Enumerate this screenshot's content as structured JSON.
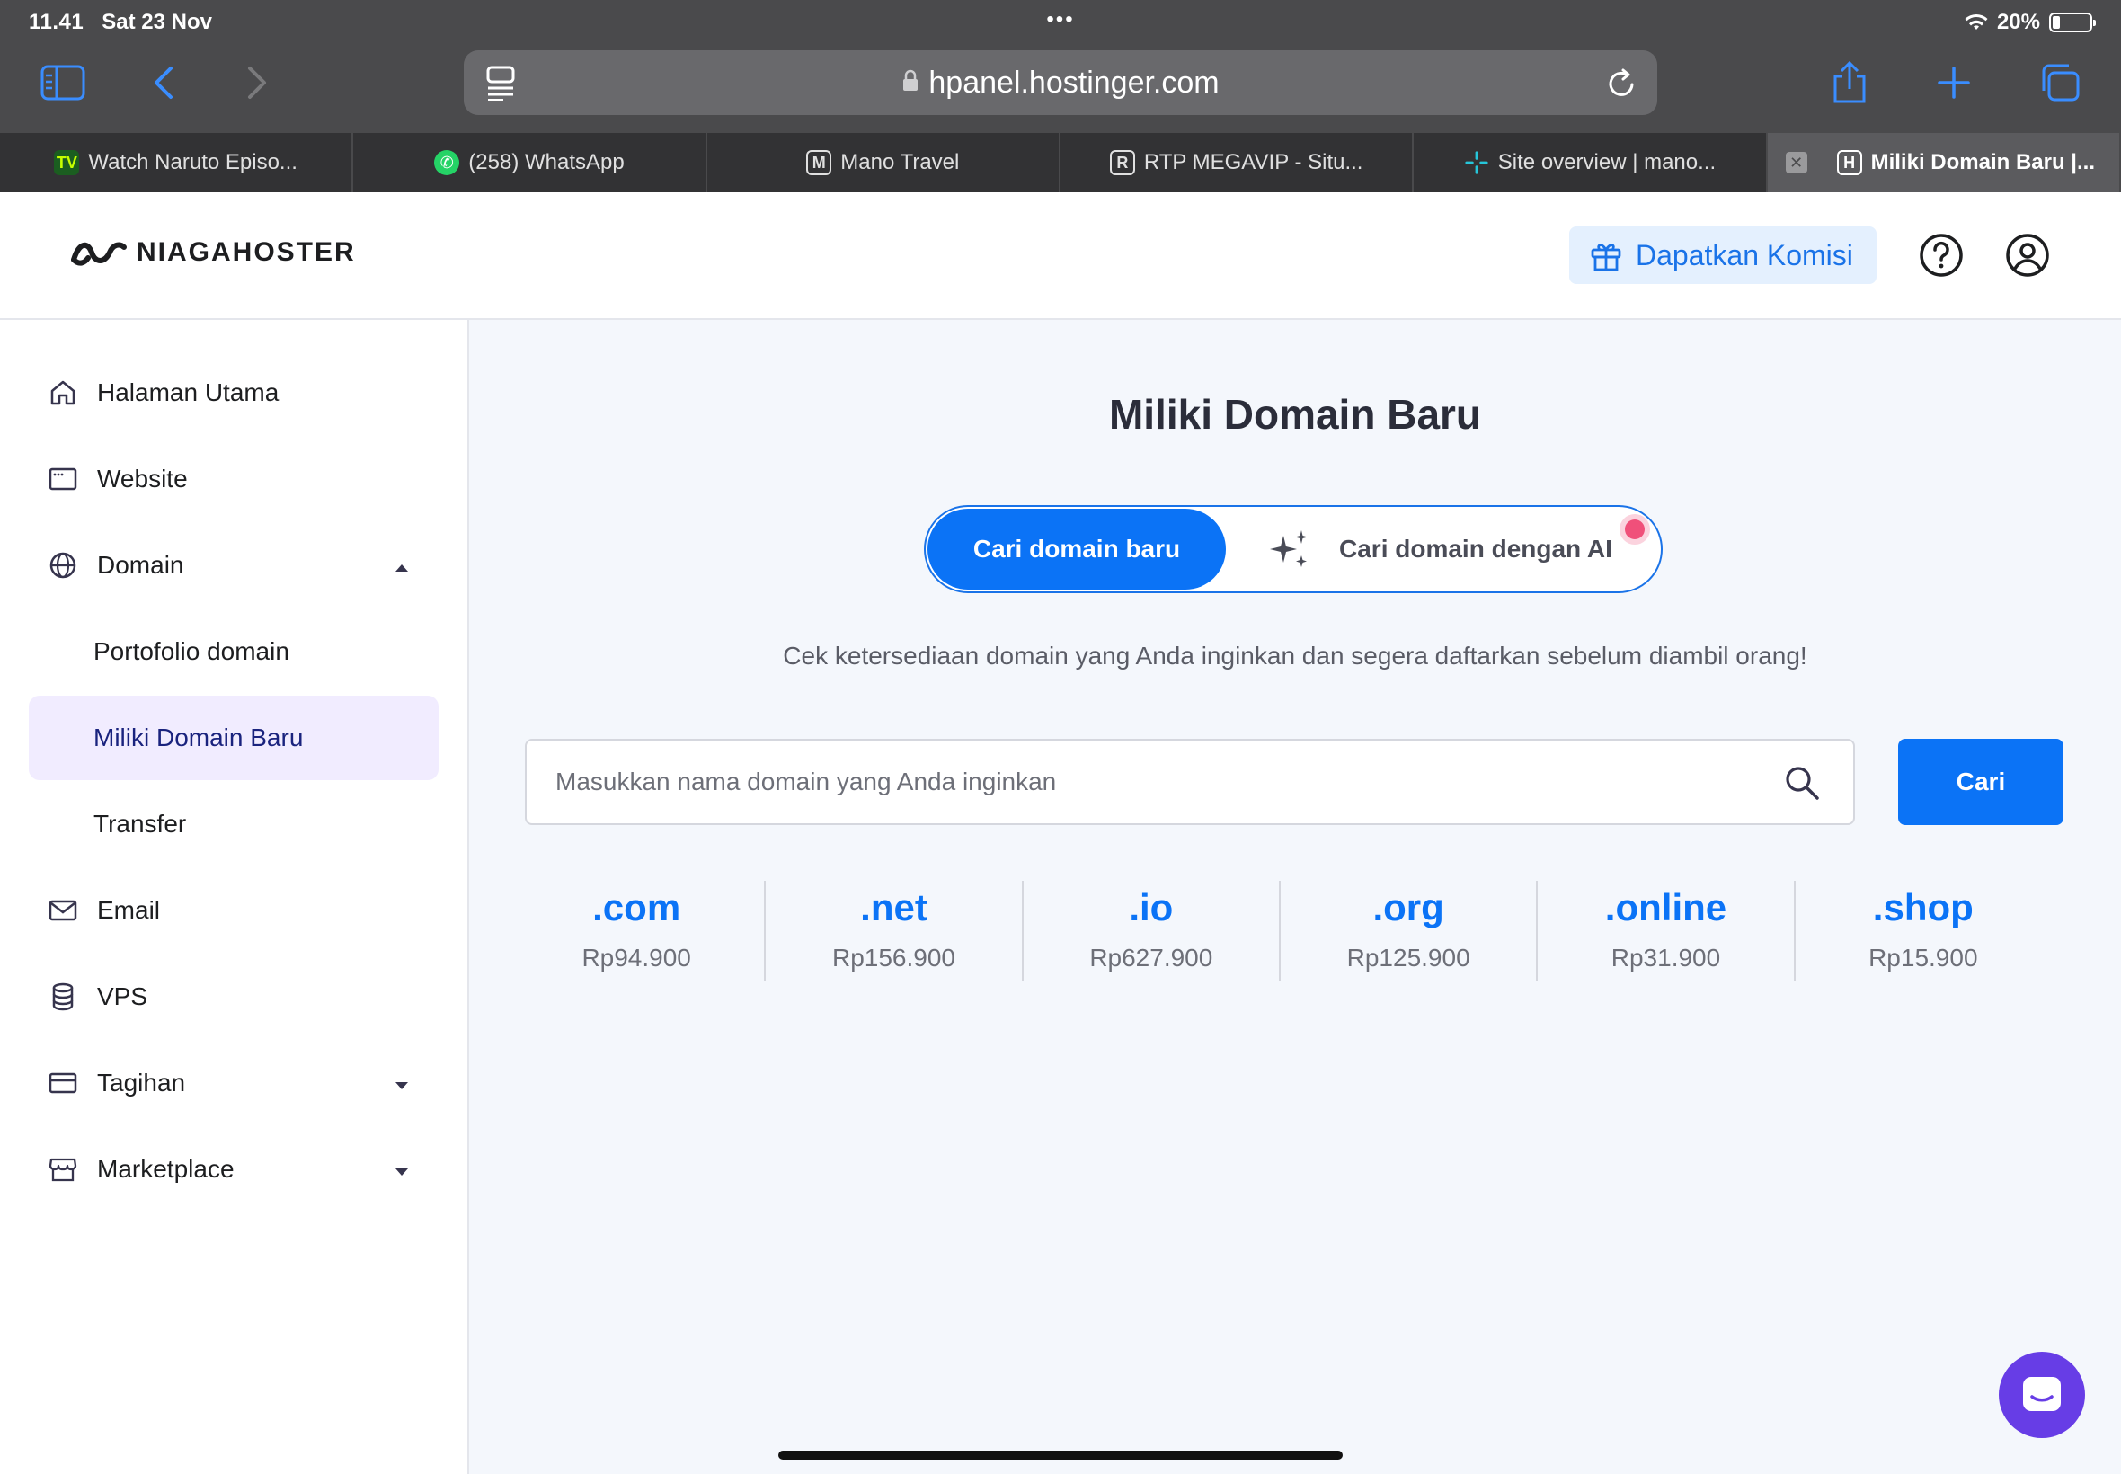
{
  "status": {
    "time": "11.41",
    "date": "Sat 23 Nov",
    "battery": "20%",
    "battery_level": 0.2
  },
  "browser": {
    "url": "hpanel.hostinger.com",
    "tabs": [
      {
        "label": "Watch Naruto Episo...",
        "icon": "TV",
        "icon_color": "#2e7d32"
      },
      {
        "label": "(258) WhatsApp",
        "icon": "whatsapp-icon",
        "icon_color": "#25d366"
      },
      {
        "label": "Mano Travel",
        "icon": "M"
      },
      {
        "label": "RTP MEGAVIP - Situ...",
        "icon": "R"
      },
      {
        "label": "Site overview | mano...",
        "icon": "spark-icon",
        "icon_color": "#26c6da"
      },
      {
        "label": "Miliki Domain Baru |...",
        "icon": "H",
        "active": true
      }
    ]
  },
  "header": {
    "logo": "NIAGAHOSTER",
    "komisi": "Dapatkan Komisi"
  },
  "sidebar": {
    "items": [
      {
        "label": "Halaman Utama",
        "icon": "home-icon"
      },
      {
        "label": "Website",
        "icon": "browser-icon"
      },
      {
        "label": "Domain",
        "icon": "globe-icon",
        "expanded": true
      },
      {
        "label": "Portofolio domain"
      },
      {
        "label": "Miliki Domain Baru",
        "active": true
      },
      {
        "label": "Transfer"
      },
      {
        "label": "Email",
        "icon": "mail-icon"
      },
      {
        "label": "VPS",
        "icon": "database-icon"
      },
      {
        "label": "Tagihan",
        "icon": "card-icon"
      },
      {
        "label": "Marketplace",
        "icon": "store-icon"
      }
    ]
  },
  "main": {
    "title": "Miliki Domain Baru",
    "toggle_on": "Cari domain baru",
    "toggle_off": "Cari domain dengan AI",
    "subtitle": "Cek ketersediaan domain yang Anda inginkan dan segera daftarkan sebelum diambil orang!",
    "search_placeholder": "Masukkan nama domain yang Anda inginkan",
    "search_button": "Cari",
    "tlds": [
      {
        "ext": ".com",
        "price": "Rp94.900"
      },
      {
        "ext": ".net",
        "price": "Rp156.900"
      },
      {
        "ext": ".io",
        "price": "Rp627.900"
      },
      {
        "ext": ".org",
        "price": "Rp125.900"
      },
      {
        "ext": ".online",
        "price": "Rp31.900"
      },
      {
        "ext": ".shop",
        "price": "Rp15.900"
      }
    ]
  },
  "colors": {
    "accent": "#0b73f6",
    "active_nav_bg": "#f1ecff",
    "chat_button": "#673de6"
  }
}
